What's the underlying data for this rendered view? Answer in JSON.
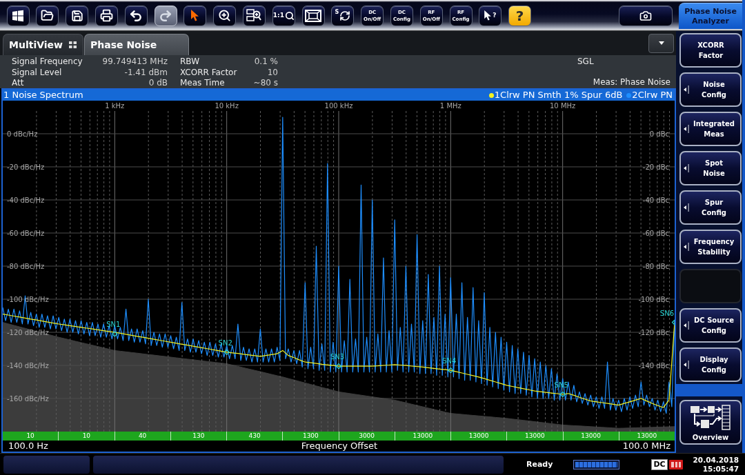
{
  "toolbar": {
    "buttons": [
      {
        "kind": "windows",
        "disabled": false
      },
      {
        "kind": "open",
        "disabled": false
      },
      {
        "kind": "save",
        "disabled": false
      },
      {
        "kind": "print",
        "disabled": false
      },
      {
        "kind": "undo",
        "disabled": false
      },
      {
        "kind": "redo",
        "disabled": true
      },
      {
        "kind": "pointer",
        "disabled": false
      },
      {
        "kind": "zoom",
        "disabled": false
      },
      {
        "kind": "multizoom",
        "disabled": false
      },
      {
        "kind": "zoom11",
        "label": "1:1",
        "disabled": false
      },
      {
        "kind": "fullscreen",
        "disabled": false
      },
      {
        "kind": "sequencer",
        "label": "S",
        "disabled": false
      },
      {
        "kind": "text",
        "label": "DC\nOn/Off",
        "disabled": false
      },
      {
        "kind": "text",
        "label": "DC\nConfig",
        "disabled": false
      },
      {
        "kind": "text",
        "label": "RF\nOn/Off",
        "disabled": false
      },
      {
        "kind": "text",
        "label": "RF\nConfig",
        "disabled": false
      },
      {
        "kind": "helppointer",
        "label": "?",
        "disabled": false
      },
      {
        "kind": "help",
        "label": "?",
        "disabled": false
      },
      {
        "kind": "camera",
        "disabled": false
      }
    ]
  },
  "app_title": "Phase Noise\nAnalyzer",
  "tabs": [
    {
      "kind": "multiview",
      "label": "MultiView",
      "selected": false
    },
    {
      "kind": "channel",
      "label": "Phase Noise",
      "selected": true
    }
  ],
  "info": {
    "left": [
      {
        "label": "Signal Frequency",
        "value": "99.749413 MHz"
      },
      {
        "label": "Signal Level",
        "value": "-1.41 dBm"
      },
      {
        "label": "Att",
        "value": "0 dB"
      }
    ],
    "middle": [
      {
        "label": "RBW",
        "value": "0.1 %"
      },
      {
        "label": "XCORR Factor",
        "value": "10"
      },
      {
        "label": "Meas Time",
        "value": "~80 s"
      }
    ],
    "mode": "SGL",
    "measurement": "Meas: Phase Noise"
  },
  "diagram": {
    "title": "1 Noise Spectrum",
    "start": "100.0 Hz",
    "stop": "100.0 MHz",
    "right_axis_labels": [
      "0 dBc",
      "-20 dBc",
      "-40 dBc",
      "-60 dBc",
      "-80 dBc",
      "-100 dBc",
      "-120 dBc",
      "-140 dBc"
    ],
    "segments": [
      "10",
      "10",
      "40",
      "130",
      "430",
      "1300",
      "3000",
      "13000",
      "13000",
      "13000",
      "13000",
      "13000"
    ],
    "chart_data": {
      "type": "line",
      "xlabel": "Frequency Offset",
      "ylim": [
        -180,
        20
      ],
      "grid": true,
      "categories": [
        null,
        null,
        null,
        null,
        null,
        null,
        null,
        null,
        null,
        null,
        null,
        null,
        null,
        null,
        null,
        null,
        null,
        null,
        null,
        null,
        null,
        null,
        null,
        null,
        null,
        null,
        null,
        null,
        null,
        null,
        null,
        null,
        null,
        null,
        null,
        null,
        null,
        null,
        null,
        null,
        "1 kHz",
        null,
        null,
        null,
        null,
        null,
        null,
        null,
        null,
        null,
        null,
        null,
        null,
        null,
        null,
        null,
        null,
        null,
        null,
        null,
        null,
        null,
        null,
        null,
        null,
        null,
        null,
        null,
        null,
        null,
        null,
        null,
        null,
        null,
        null,
        null,
        null,
        null,
        null,
        null,
        "10 kHz",
        null,
        null,
        null,
        null,
        null,
        null,
        null,
        null,
        null,
        null,
        null,
        null,
        null,
        null,
        null,
        null,
        null,
        null,
        null,
        null,
        null,
        null,
        null,
        null,
        null,
        null,
        null,
        null,
        null,
        null,
        null,
        null,
        null,
        null,
        null,
        null,
        null,
        null,
        null,
        "100 kHz",
        null,
        null,
        null,
        null,
        null,
        null,
        null,
        null,
        null,
        null,
        null,
        null,
        null,
        null,
        null,
        null,
        null,
        null,
        null,
        null,
        null,
        null,
        null,
        null,
        null,
        null,
        null,
        null,
        null,
        null,
        null,
        null,
        null,
        null,
        null,
        null,
        null,
        null,
        null,
        "1 MHz",
        null,
        null,
        null,
        null,
        null,
        null,
        null,
        null,
        null,
        null,
        null,
        null,
        null,
        null,
        null,
        null,
        null,
        null,
        null,
        null,
        null,
        null,
        null,
        null,
        null,
        null,
        null,
        null,
        null,
        null,
        null,
        null,
        null,
        null,
        null,
        null,
        null,
        null,
        null,
        "10 MHz",
        null,
        null,
        null,
        null,
        null,
        null,
        null,
        null,
        null,
        null,
        null,
        null,
        null,
        null,
        null,
        null,
        null,
        null,
        null,
        null,
        null,
        null,
        null,
        null,
        null,
        null,
        null,
        null,
        null,
        null,
        null,
        null,
        null,
        null,
        null,
        null,
        null,
        null,
        null,
        null
      ],
      "yticks": [
        {
          "value": 0,
          "label": "0 dBc/Hz"
        },
        {
          "value": -20,
          "label": "-20 dBc/Hz"
        },
        {
          "value": -40,
          "label": "-40 dBc/Hz"
        },
        {
          "value": -60,
          "label": "-60 dBc/Hz"
        },
        {
          "value": -80,
          "label": "-80 dBc/Hz"
        },
        {
          "value": -100,
          "label": "-100 dBc/Hz"
        },
        {
          "value": -120,
          "label": "-120 dBc/Hz"
        },
        {
          "value": -140,
          "label": "-140 dBc/Hz"
        },
        {
          "value": -160,
          "label": "-160 dBc/Hz"
        }
      ],
      "series": [
        {
          "type": "line",
          "color": "#3c3c3c",
          "values": [
            -114,
            null,
            -114.9,
            null,
            -115.8,
            null,
            -116.7,
            null,
            -117.6,
            null,
            -118.5,
            null,
            -119.4,
            null,
            -120.3,
            null,
            -121.2,
            null,
            -122.1,
            null,
            -123,
            null,
            -123.8,
            null,
            -124.6,
            null,
            -125.4,
            null,
            -126.2,
            null,
            -127,
            null,
            -127.8,
            null,
            -128.6,
            null,
            -129.4,
            null,
            -130.2,
            null,
            -131,
            null,
            -131.4,
            null,
            -131.8,
            null,
            -132.2,
            null,
            -132.6,
            null,
            -133,
            null,
            -133.4,
            null,
            -133.8,
            null,
            -134.2,
            null,
            -134.6,
            null,
            -135,
            null,
            -135.4,
            null,
            -135.8,
            null,
            -136.2,
            null,
            -136.6,
            null,
            -137,
            null,
            -137.4,
            null,
            -137.8,
            null,
            -138.2,
            null,
            -138.6,
            null,
            -139,
            null,
            -139.8,
            null,
            -140.6,
            null,
            -141.4,
            null,
            -142.2,
            null,
            -143,
            null,
            -143.8,
            null,
            -144.6,
            null,
            -145.4,
            null,
            -146.2,
            null,
            -147,
            null,
            -147.9,
            null,
            -148.8,
            null,
            -149.7,
            null,
            -150.6,
            null,
            -151.5,
            null,
            -152.4,
            null,
            -153.3,
            null,
            -154.2,
            null,
            -155.1,
            null,
            -156,
            null,
            -156.5,
            null,
            -157,
            null,
            -157.5,
            null,
            -158,
            null,
            -158.5,
            null,
            -159,
            null,
            -159.5,
            null,
            -160,
            null,
            -160.5,
            null,
            -161,
            null,
            -161.8,
            null,
            -162.6,
            null,
            -163.4,
            null,
            -164.2,
            null,
            -165,
            null,
            -165.8,
            null,
            -166.6,
            null,
            -167.4,
            null,
            -168.2,
            null,
            -169,
            null,
            -169.3,
            null,
            -169.6,
            null,
            -169.9,
            null,
            -170.2,
            null,
            -170.5,
            null,
            -170.8,
            null,
            -171.1,
            null,
            -171.4,
            null,
            -171.7,
            null,
            -172,
            null,
            -172.4,
            null,
            -172.8,
            null,
            -173.2,
            null,
            -173.6,
            null,
            -174,
            null,
            -174.4,
            null,
            -174.8,
            null,
            -175.2,
            null,
            -175.6,
            null,
            -176,
            null,
            -176.2,
            null,
            -176.4,
            null,
            -176.6,
            null,
            -176.8,
            null,
            -177,
            null,
            -177.2,
            null,
            -177.4,
            null,
            -177.6,
            null,
            -177.8,
            null,
            -178,
            null,
            -177.9,
            null,
            -177.8,
            null,
            -177.7,
            null,
            -177.6,
            null,
            -177.5,
            null,
            -177.4,
            null,
            -177.3,
            null,
            -177.2,
            null,
            -177.1,
            null,
            -177
          ]
        },
        {
          "type": "line",
          "name": "1Clrw PN Smth 1% Spur 6dB",
          "color": "#f2f222",
          "values": [
            -109,
            null,
            -109.6,
            null,
            -110.2,
            null,
            -110.8,
            null,
            -111.4,
            null,
            -112,
            null,
            -112.6,
            null,
            -113.2,
            null,
            -113.8,
            null,
            -114.4,
            null,
            -115,
            null,
            -115.5,
            null,
            -116,
            null,
            -116.5,
            null,
            -117,
            null,
            -117.5,
            null,
            -118,
            null,
            -118.5,
            null,
            -119,
            null,
            -119.5,
            null,
            -120,
            null,
            -120.6,
            null,
            -121.2,
            null,
            -121.8,
            null,
            -122.4,
            null,
            -123,
            null,
            -123.6,
            null,
            -124.2,
            null,
            -124.8,
            null,
            -125.4,
            null,
            -126,
            null,
            -126.6,
            null,
            -127.2,
            null,
            -127.8,
            null,
            -128.4,
            null,
            -129,
            null,
            -129.6,
            null,
            -130.2,
            null,
            -130.8,
            null,
            -131.4,
            null,
            -132,
            null,
            -132.4,
            null,
            -132.8,
            null,
            -133.3,
            null,
            -133.7,
            null,
            -134.1,
            null,
            -134.5,
            null,
            -134,
            null,
            -133.5,
            null,
            -133,
            null,
            -131,
            null,
            -134,
            null,
            -135.3,
            null,
            -136.7,
            null,
            -138,
            null,
            -138.4,
            null,
            -138.8,
            null,
            -139.3,
            null,
            -139.7,
            null,
            -140.1,
            null,
            -140.5,
            null,
            -140.5,
            null,
            -140.5,
            null,
            -140.5,
            null,
            -140.5,
            null,
            -140.5,
            null,
            -140.5,
            null,
            -140.3,
            null,
            -140,
            null,
            -139.8,
            null,
            -139.5,
            null,
            -139.8,
            null,
            -140.1,
            null,
            -140.4,
            null,
            -140.7,
            null,
            -141,
            null,
            -141.4,
            null,
            -141.8,
            null,
            -142.2,
            null,
            -142.6,
            null,
            -143,
            null,
            -143.8,
            null,
            -144.6,
            null,
            -145.4,
            null,
            -146.2,
            null,
            -147,
            null,
            -148,
            null,
            -149,
            null,
            -150,
            null,
            -151,
            null,
            -152,
            null,
            -152.7,
            null,
            -153.4,
            null,
            -154.1,
            null,
            -154.8,
            null,
            -155.5,
            null,
            -155.9,
            null,
            -156.3,
            null,
            -156.7,
            null,
            -157.1,
            null,
            -157.5,
            null,
            -157,
            null,
            -158.1,
            null,
            -159.3,
            null,
            -160.4,
            null,
            -161.5,
            null,
            -162,
            null,
            -162.5,
            null,
            -163,
            null,
            -163.5,
            null,
            -164,
            null,
            -163,
            null,
            -162,
            null,
            -161,
            null,
            -160,
            null,
            -161.5,
            null,
            -163,
            null,
            -164.3,
            null,
            -165.5,
            null,
            -161,
            null,
            -114
          ]
        },
        {
          "type": "line",
          "name": "2Clrw PN",
          "color": "#1e8fff",
          "values": [
            -105,
            -113,
            -106,
            -114,
            -106,
            -114,
            -107,
            -115,
            -98,
            -115,
            -108,
            -116,
            -109,
            -117,
            -109,
            -117,
            -110,
            -118,
            -110,
            -118,
            -111,
            -119,
            -112,
            -120,
            -112,
            -120,
            -113,
            -121,
            -113,
            -121,
            -114,
            -122,
            -114,
            -122,
            -115,
            -123,
            -115,
            -123,
            -116,
            -124,
            -116,
            -124,
            -117,
            -125,
            -106,
            -125,
            -118,
            -126,
            -118,
            -126,
            -119,
            -127,
            -100,
            -128,
            -120,
            -128,
            -121,
            -129,
            -121,
            -129,
            -122,
            -130,
            -123,
            -131,
            -102,
            -131,
            -124,
            -132,
            -124,
            -132,
            -125,
            -133,
            -126,
            -134,
            -126,
            -134,
            -127,
            -135,
            -127,
            -135,
            -128,
            -136,
            -128,
            -136,
            -115,
            -137,
            -129,
            -137,
            -130,
            -138,
            -130,
            -138,
            -118,
            -138,
            -130,
            -138,
            -130,
            -138,
            -129,
            -137,
            10,
            -136,
            -130,
            -138,
            -131,
            -139,
            -131,
            -141,
            -90,
            -142,
            -129,
            -142,
            -68,
            -143,
            -127,
            -143,
            -18,
            -144,
            -126,
            -144,
            -80,
            -144,
            -125,
            -144,
            -88,
            -144,
            -124,
            -144,
            -31,
            -144,
            -123,
            -144,
            -40,
            -144,
            -121,
            -144,
            -75,
            -144,
            -119,
            -144,
            -52,
            -143,
            -117,
            -144,
            -80,
            -144,
            -115,
            -144,
            -61,
            -145,
            -113,
            -145,
            -85,
            -145,
            -111,
            -146,
            -80,
            -146,
            -109,
            -147,
            -87,
            -147,
            -109,
            -148,
            -90,
            -149,
            -111,
            -149,
            -93,
            -150,
            -113,
            -151,
            -96,
            -152,
            -117,
            -153,
            -120,
            -154,
            -123,
            -155,
            -126,
            -156,
            -128,
            -157,
            -130,
            -157,
            -132,
            -158,
            -134,
            -159,
            -136,
            -160,
            -138,
            -160,
            -140,
            -160,
            -142,
            -161,
            -145,
            -161,
            -148,
            -161,
            -150,
            -161,
            -152,
            -162,
            -156,
            -163,
            -157,
            -164,
            -158,
            -165,
            -159,
            -166,
            -159,
            -166,
            -138,
            -167,
            -160,
            -167,
            -161,
            -168,
            -160,
            -167,
            -159,
            -166,
            -158,
            -165,
            -150,
            -164,
            -158,
            -165,
            -160,
            -167,
            -161,
            -168,
            -162,
            -169,
            -150,
            -165,
            -113
          ]
        }
      ],
      "annotations": [
        {
          "x": "1 kHz",
          "y": -121,
          "text": "SN1"
        },
        {
          "x": "10 kHz",
          "y": -132,
          "text": "SN2"
        },
        {
          "x": "100 kHz",
          "y": -140.5,
          "text": "SN3"
        },
        {
          "x": "1 MHz",
          "y": -143,
          "text": "SN4"
        },
        {
          "x": "10 MHz",
          "y": -157.5,
          "text": "SN5"
        },
        "SN6"
      ]
    }
  },
  "softkeys": [
    {
      "kind": "plain",
      "label": "XCORR\nFactor"
    },
    {
      "kind": "submenu",
      "label": "Noise\nConfig"
    },
    {
      "kind": "submenu",
      "label": "Integrated\nMeas"
    },
    {
      "kind": "submenu",
      "label": "Spot\nNoise"
    },
    {
      "kind": "submenu",
      "label": "Spur\nConfig"
    },
    {
      "kind": "submenu",
      "label": "Frequency\nStability"
    },
    {
      "kind": "blank"
    },
    {
      "kind": "submenu",
      "label": "DC Source\nConfig"
    },
    {
      "kind": "submenu",
      "label": "Display\nConfig"
    },
    {
      "kind": "spacer"
    },
    {
      "kind": "overview",
      "label": "Overview"
    }
  ],
  "status_bar": {
    "message": "Ready",
    "progress": {
      "level": 1
    },
    "dc": "DC",
    "date": "20.04.2018",
    "time": "15:05:47"
  }
}
